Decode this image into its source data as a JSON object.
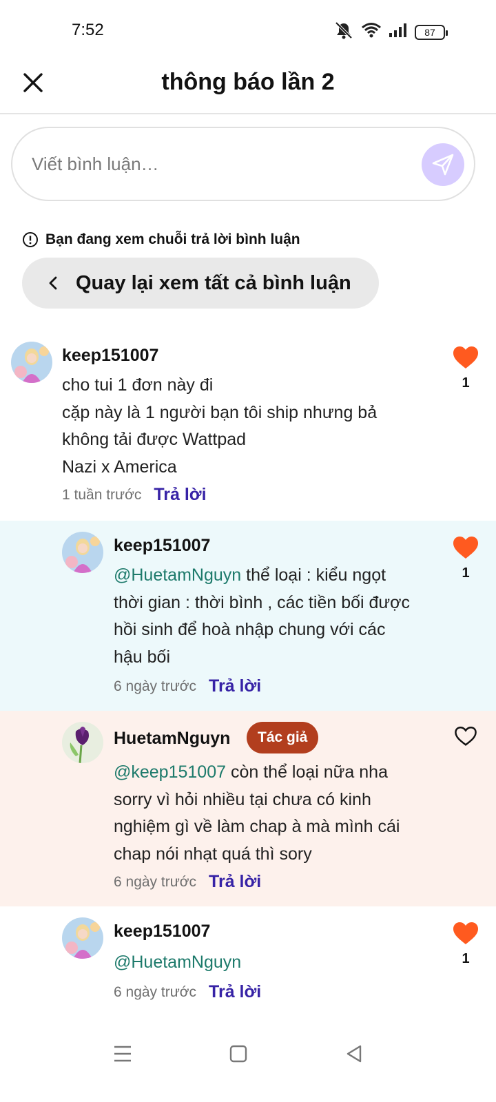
{
  "status_bar": {
    "time": "7:52",
    "battery": "87"
  },
  "header": {
    "title": "thông báo lần 2"
  },
  "comment_input": {
    "placeholder": "Viết bình luận…"
  },
  "thread_notice": {
    "text": "Bạn đang xem chuỗi trả lời bình luận"
  },
  "back_button": {
    "label": "Quay lại xem tất cả bình luận"
  },
  "comments": [
    {
      "user": "keep151007",
      "lines": [
        "cho tui 1 đơn này đi",
        "cặp này là 1 người bạn tôi ship nhưng bả",
        "không tải được Wattpad",
        "Nazi x America"
      ],
      "time": "1 tuần trước",
      "reply": "Trả lời",
      "likes": "1",
      "liked": true
    },
    {
      "user": "keep151007",
      "mention": "@HuetamNguyn",
      "lines": [
        " thể loại : kiểu ngọt",
        "thời gian : thời bình , các tiền bối được",
        "hồi sinh để hoà nhập chung với các",
        "hậu bối"
      ],
      "time": "6 ngày trước",
      "reply": "Trả lời",
      "likes": "1",
      "liked": true
    },
    {
      "user": "HuetamNguyn",
      "badge": "Tác giả",
      "mention": "@keep151007",
      "lines": [
        " còn thể loại nữa nha",
        "sorry vì hỏi nhiều tại chưa có kinh",
        "nghiệm gì về làm chap à mà mình cái",
        "chap nói nhạt quá thì sory"
      ],
      "time": "6 ngày trước",
      "reply": "Trả lời",
      "liked": false
    },
    {
      "user": "keep151007",
      "mention": "@HuetamNguyn",
      "time": "6 ngày trước",
      "reply": "Trả lời",
      "likes": "1",
      "liked": true
    }
  ],
  "colors": {
    "accent": "#3723a6",
    "heart": "#ff5a1f",
    "mention": "#1d7a6b",
    "author_badge": "#b23e1e"
  }
}
